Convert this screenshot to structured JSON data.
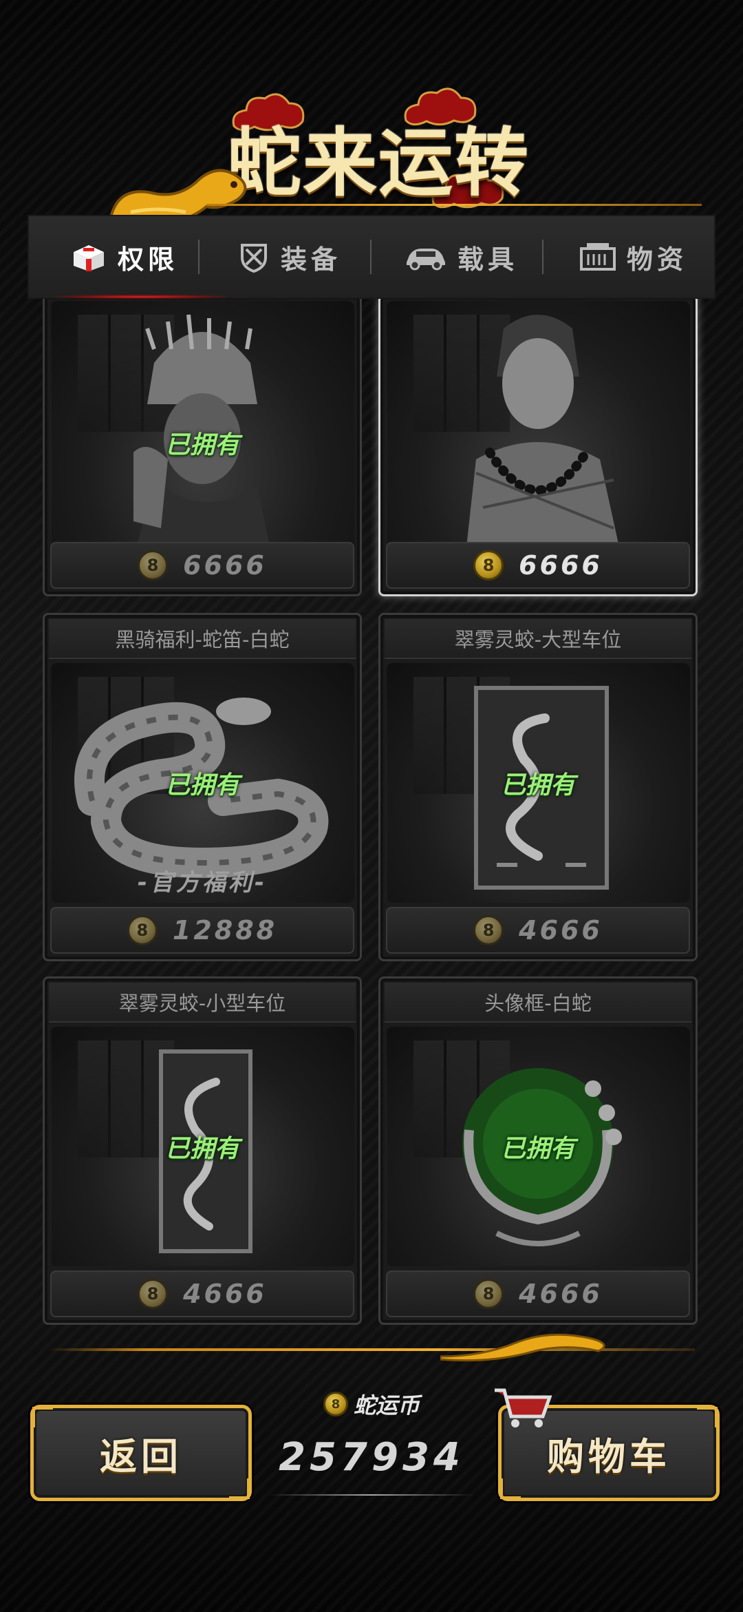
{
  "header": {
    "title": "蛇来运转"
  },
  "tabs": [
    {
      "label": "权限",
      "icon": "box-icon",
      "active": true
    },
    {
      "label": "装备",
      "icon": "armor-icon",
      "active": false
    },
    {
      "label": "载具",
      "icon": "car-icon",
      "active": false
    },
    {
      "label": "物资",
      "icon": "supplies-icon",
      "active": false
    }
  ],
  "cards": [
    {
      "name": "",
      "status": "已拥有",
      "price": "6666",
      "selected": false,
      "image": "miao-woman-portrait"
    },
    {
      "name": "",
      "status": "",
      "price": "6666",
      "selected": true,
      "image": "monk-man-portrait"
    },
    {
      "name": "黑骑福利-蛇笛-白蛇",
      "status": "已拥有",
      "promo": "-官方福利-",
      "price": "12888",
      "selected": false,
      "image": "white-snake"
    },
    {
      "name": "翠雾灵蛟-大型车位",
      "status": "已拥有",
      "price": "4666",
      "selected": false,
      "image": "snake-parking-large"
    },
    {
      "name": "翠雾灵蛟-小型车位",
      "status": "已拥有",
      "price": "4666",
      "selected": false,
      "image": "snake-parking-small"
    },
    {
      "name": "头像框-白蛇",
      "status": "已拥有",
      "price": "4666",
      "selected": false,
      "image": "snake-avatar-frame"
    }
  ],
  "footer": {
    "back_label": "返回",
    "currency_label": "蛇运币",
    "currency_value": "257934",
    "cart_label": "购物车"
  },
  "colors": {
    "owned_green": "#9cf07a",
    "gold": "#e3b23a",
    "selected_border": "#d4d4d4"
  }
}
